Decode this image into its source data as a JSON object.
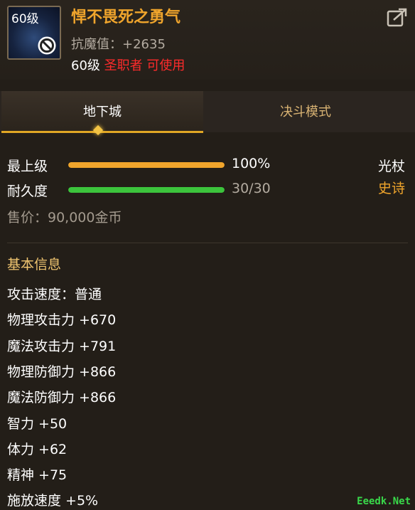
{
  "item": {
    "level_badge": "60级",
    "name": "悍不畏死之勇气",
    "magic_resist": "抗魔值：+2635",
    "req_level": "60级",
    "req_class": "圣职者",
    "req_usable": "可使用"
  },
  "tabs": [
    {
      "label": "地下城",
      "active": true
    },
    {
      "label": "决斗模式",
      "active": false
    }
  ],
  "bars": {
    "upgrade": {
      "label": "最上级",
      "value": "100%",
      "fraction": 1.0,
      "color": "#f0a52c"
    },
    "durability": {
      "label": "耐久度",
      "value": "30/30",
      "fraction": 1.0,
      "color": "#3cc43c"
    }
  },
  "weapon_type": "光杖",
  "rarity": "史诗",
  "price": "售价：90,000金币",
  "basic_info": {
    "title": "基本信息",
    "attributes": [
      "攻击速度：普通",
      "物理攻击力 +670",
      "魔法攻击力 +791",
      "物理防御力 +866",
      "魔法防御力 +866",
      "智力 +50",
      "体力 +62",
      "精神 +75",
      "施放速度 +5%"
    ]
  },
  "watermark": "Eeedk.Net",
  "icons": [
    "ban-icon",
    "share-icon"
  ]
}
